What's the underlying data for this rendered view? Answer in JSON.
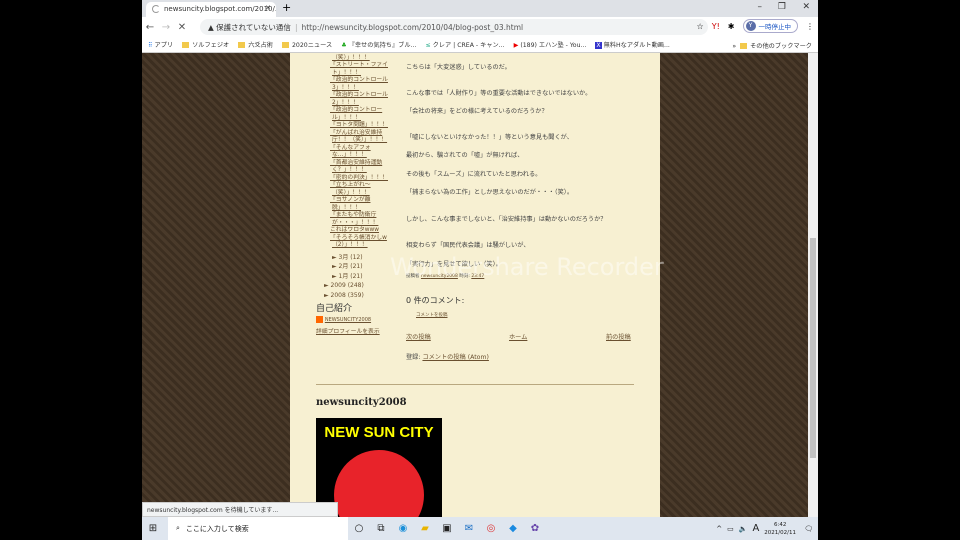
{
  "browser": {
    "tab_title": "newsuncity.blogspot.com/2010/...",
    "security_label": "保護されていない通信",
    "url": "http://newsuncity.blogspot.com/2010/04/blog-post_03.html",
    "profile_label": "一時停止中",
    "profile_initial": "Y",
    "bookmarks": [
      "アプリ",
      "ソルフェジオ",
      "六爻占術",
      "2020ニュース",
      "『幸せの気持ち』ブル...",
      "クレア | CREA - キャン...",
      "(189) エハン塾 - You...",
      "無料Hなアダルト動画..."
    ],
    "other_bookmarks": "その他のブックマーク",
    "status": "newsuncity.blogspot.com を待機しています..."
  },
  "sidebar": {
    "links": [
      "「ようやく理解出来た（笑）」！！！",
      "「ストリート・ファイト」！！！",
      "「政治的コントロール3」！！！",
      "「政治的コントロール2」！！！",
      "「政治的コントロール」！！！",
      "「ヨトタ問題」！！！",
      "「がんばれ治安維持庁！！（笑）」！！！",
      "「そんなアフォな…」！！！",
      "「首都治安維持運動く？」！！！",
      "「密約の判決」！！！",
      "「立ち上がれ～（笑）」！！！",
      "「ヨサノンが離脱」！！！",
      "「またもや防衛庁が・・・」！！！",
      "これはワロタwww",
      "「そろそろ帳消かしw（2）」！！！"
    ],
    "archive": [
      "3月 (12)",
      "2月 (21)",
      "1月 (21)",
      "2009 (248)",
      "2008 (359)"
    ],
    "profile_heading": "自己紹介",
    "profile_name": "NEWSUNCITY2008",
    "profile_link": "詳細プロフィールを表示",
    "blog_title": "newsuncity2008",
    "logo_text": "NEW SUN CITY"
  },
  "post": {
    "lines": [
      "こちらは「大変迷惑」しているのだ。",
      "こんな事では「人財作り」等の重要な活動はできないではないか。",
      "「会社の将来」をどの様に考えているのだろうか？",
      "「嘘にしないといけなかった！！」等という意見も聞くが、",
      "最初から、騙されての「嘘」が無ければ、",
      "その後も「スムーズ」に流れていたと思われる。",
      "「捕まらない為の工作」としか思えないのだが・・・（笑）。",
      "しかし、こんな事までしないと、「治安維持事」は動かないのだろうか？",
      "相変わらず「国民代表会議」は騒がしいが、",
      "「実行力」を見せて欲しい（笑）。"
    ],
    "footer_prefix": "投稿者",
    "footer_author": "newsuncity2008",
    "footer_time_label": "時刻:",
    "footer_time": "23:47",
    "comments_heading": "0 件のコメント:",
    "post_comment": "コメントを投稿",
    "newer": "次の投稿",
    "home": "ホーム",
    "older": "前の投稿",
    "subscribe_label": "登録:",
    "subscribe_link": "コメントの投稿 (Atom)"
  },
  "watermark": "Wondershare Recorder",
  "taskbar": {
    "search_placeholder": "ここに入力して検索",
    "time": "6:42",
    "date": "2021/02/11",
    "ime": "A"
  }
}
